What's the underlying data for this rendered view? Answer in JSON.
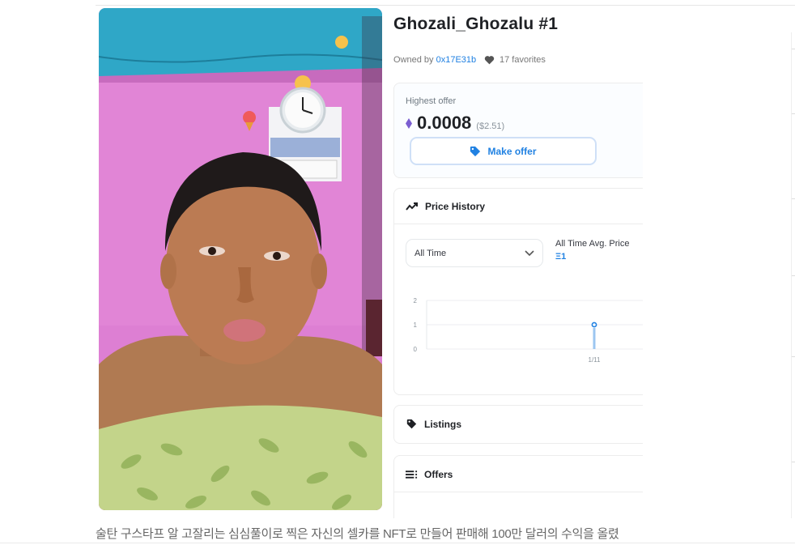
{
  "nft": {
    "title": "Ghozali_Ghozalu #1",
    "owned_prefix": "Owned by ",
    "owner_address": "0x17E31b",
    "favorites": "17 favorites"
  },
  "offer": {
    "label": "Highest offer",
    "price": "0.0008",
    "usd": "($2.51)",
    "button": "Make offer"
  },
  "price_history": {
    "heading": "Price History",
    "select_value": "All Time",
    "avg_label": "All Time Avg. Price",
    "avg_value": "Ξ1"
  },
  "chart_data": {
    "type": "line",
    "x": [
      "1/11"
    ],
    "y": [
      1
    ],
    "y_ticks": [
      "2",
      "1",
      "0"
    ],
    "ylim": [
      0,
      2
    ],
    "grid": true,
    "series_color": "#2081e2"
  },
  "sections": {
    "listings": "Listings",
    "offers": "Offers"
  },
  "caption": "술탄 구스타프 알 고잘리는 심심풀이로 찍은 자신의 셀카를 NFT로 만들어 판매해 100만 달러의 수익을 올렸",
  "colors": {
    "accent": "#2081e2",
    "wall": "#dd7fd3",
    "ceiling": "#2fa7c7"
  },
  "icons": {
    "eth": "ethereum-icon",
    "heart": "heart-icon",
    "tag": "tag-icon",
    "trend": "trending-icon",
    "list": "list-icon"
  }
}
